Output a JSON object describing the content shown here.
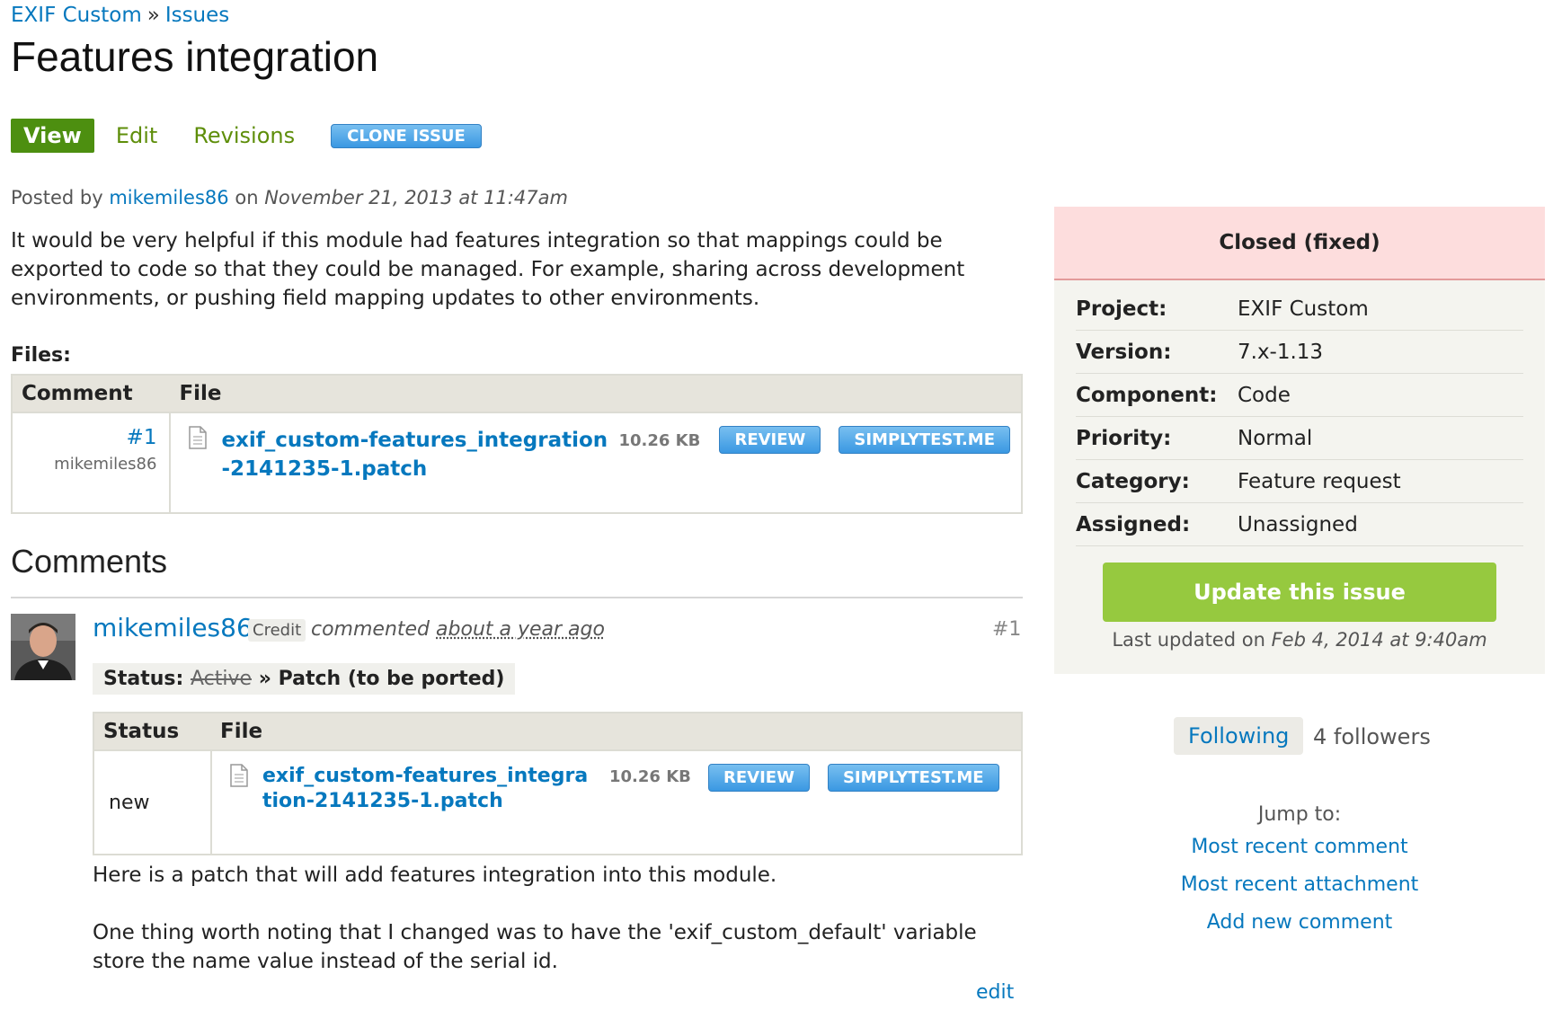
{
  "breadcrumb": {
    "project": "EXIF Custom",
    "separator": "»",
    "issues": "Issues"
  },
  "title": "Features integration",
  "tabs": {
    "view": "View",
    "edit": "Edit",
    "revisions": "Revisions",
    "clone": "CLONE ISSUE"
  },
  "post": {
    "posted_by": "Posted by",
    "author": "mikemiles86",
    "on": "on",
    "date": "November 21, 2013 at 11:47am",
    "body": "It would be very helpful if this module had features integration so that mappings could be exported to code so that they could be managed. For example, sharing across development environments, or pushing field mapping updates to other environments."
  },
  "files": {
    "label": "Files:",
    "headers": {
      "comment": "Comment",
      "file": "File"
    },
    "rows": [
      {
        "comment_num": "#1",
        "comment_author": "mikemiles86",
        "file_name": "exif_custom-features_integration-2141235-1.patch",
        "size": "10.26 KB",
        "review": "REVIEW",
        "simplytest": "SIMPLYTEST.ME"
      }
    ]
  },
  "comments": {
    "heading": "Comments",
    "items": [
      {
        "author": "mikemiles86",
        "credit": "Credit",
        "commented": "commented",
        "ago": "about a year ago",
        "number": "#1",
        "status_label": "Status:",
        "status_old": "Active",
        "status_arrow": "»",
        "status_new": "Patch (to be ported)",
        "table_headers": {
          "status": "Status",
          "file": "File"
        },
        "file_status": "new",
        "file_name": "exif_custom-features_integration-2141235-1.patch",
        "file_size": "10.26 KB",
        "review": "REVIEW",
        "simplytest": "SIMPLYTEST.ME",
        "text1": "Here is a patch that will add features integration into this module.",
        "text2": "One thing worth noting that I changed was to have the 'exif_custom_default' variable store the name value instead of the serial id.",
        "edit": "edit"
      }
    ]
  },
  "sidebar": {
    "status": "Closed (fixed)",
    "meta": [
      {
        "key": "Project:",
        "value": "EXIF Custom"
      },
      {
        "key": "Version:",
        "value": "7.x-1.13"
      },
      {
        "key": "Component:",
        "value": "Code"
      },
      {
        "key": "Priority:",
        "value": "Normal"
      },
      {
        "key": "Category:",
        "value": "Feature request"
      },
      {
        "key": "Assigned:",
        "value": "Unassigned"
      }
    ],
    "update_button": "Update this issue",
    "last_updated_label": "Last updated on",
    "last_updated_date": "Feb 4, 2014 at 9:40am",
    "following": "Following",
    "followers": "4 followers",
    "jump_to": "Jump to:",
    "jump_links": [
      "Most recent comment",
      "Most recent attachment",
      "Add new comment"
    ]
  },
  "colors": {
    "link": "#0678be",
    "active_tab": "#4d8f10",
    "update_button": "#96c93f",
    "status_banner": "#fddddd",
    "sidebar_bg": "#f4f4ef"
  },
  "icons": {
    "file": "file-icon",
    "avatar": "avatar"
  }
}
